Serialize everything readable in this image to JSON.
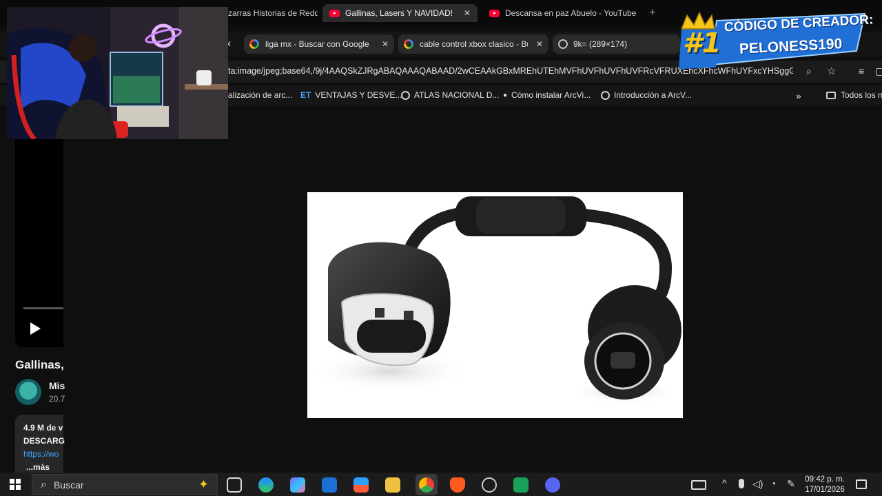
{
  "tabs": [
    {
      "label": "zarras Historias de Reddit",
      "active": false,
      "icon": "none"
    },
    {
      "label": "Gallinas, Lasers Y NAVIDAD! | BA",
      "active": true,
      "icon": "youtube-icon"
    },
    {
      "label": "Descansa en paz Abuelo - YouTube",
      "active": false,
      "icon": "youtube-icon"
    }
  ],
  "group_tabs": [
    {
      "label": "liga mx - Buscar con Google",
      "icon": "google-icon"
    },
    {
      "label": "cable control xbox clasico - Bus",
      "icon": "google-icon"
    },
    {
      "label": "9k= (289×174)",
      "icon": "globe-icon"
    }
  ],
  "address": {
    "url_prefix": "ta:image/jpeg;base64,/9j/4AAQSkZJRgABAQAAAQABAAD/2wCEAAkGBxMREhUTEhMVFhUVFhUVFhUVFRcVFRUXEhcXFhcWFhUYFxcYHSggGBom..."
  },
  "bookmarks": [
    {
      "label": "alización de arc...",
      "icon": "none"
    },
    {
      "label": "VENTAJAS Y DESVE...",
      "icon": "et-icon"
    },
    {
      "label": "ATLAS NACIONAL D...",
      "icon": "globe-icon"
    },
    {
      "label": "Cómo instalar ArcVi...",
      "icon": "dot-icon"
    },
    {
      "label": "Introducción a ArcV...",
      "icon": "globe-icon"
    },
    {
      "label": "»",
      "icon": "overflow"
    },
    {
      "label": "Todos los m",
      "icon": "folder-icon"
    }
  ],
  "youtube": {
    "title_fragment": "Gallinas,",
    "channel_fragment": "Mis",
    "subs_fragment": "20.7",
    "views_fragment": "4.9 M de v",
    "desc_fragment": "DESCARG",
    "link_fragment": "https://wo",
    "more_label": "...más"
  },
  "creator": {
    "rank": "#1",
    "line1": "CÓDIGO DE CREADOR:",
    "line2": "PELONESS190"
  },
  "taskbar": {
    "search_placeholder": "Buscar",
    "time": "09:42 p. m.",
    "date": "17/01/2026"
  },
  "colors": {
    "youtube_red": "#ff0033",
    "banner_blue": "#1f6fd6",
    "banner_gold": "#f5c518"
  }
}
